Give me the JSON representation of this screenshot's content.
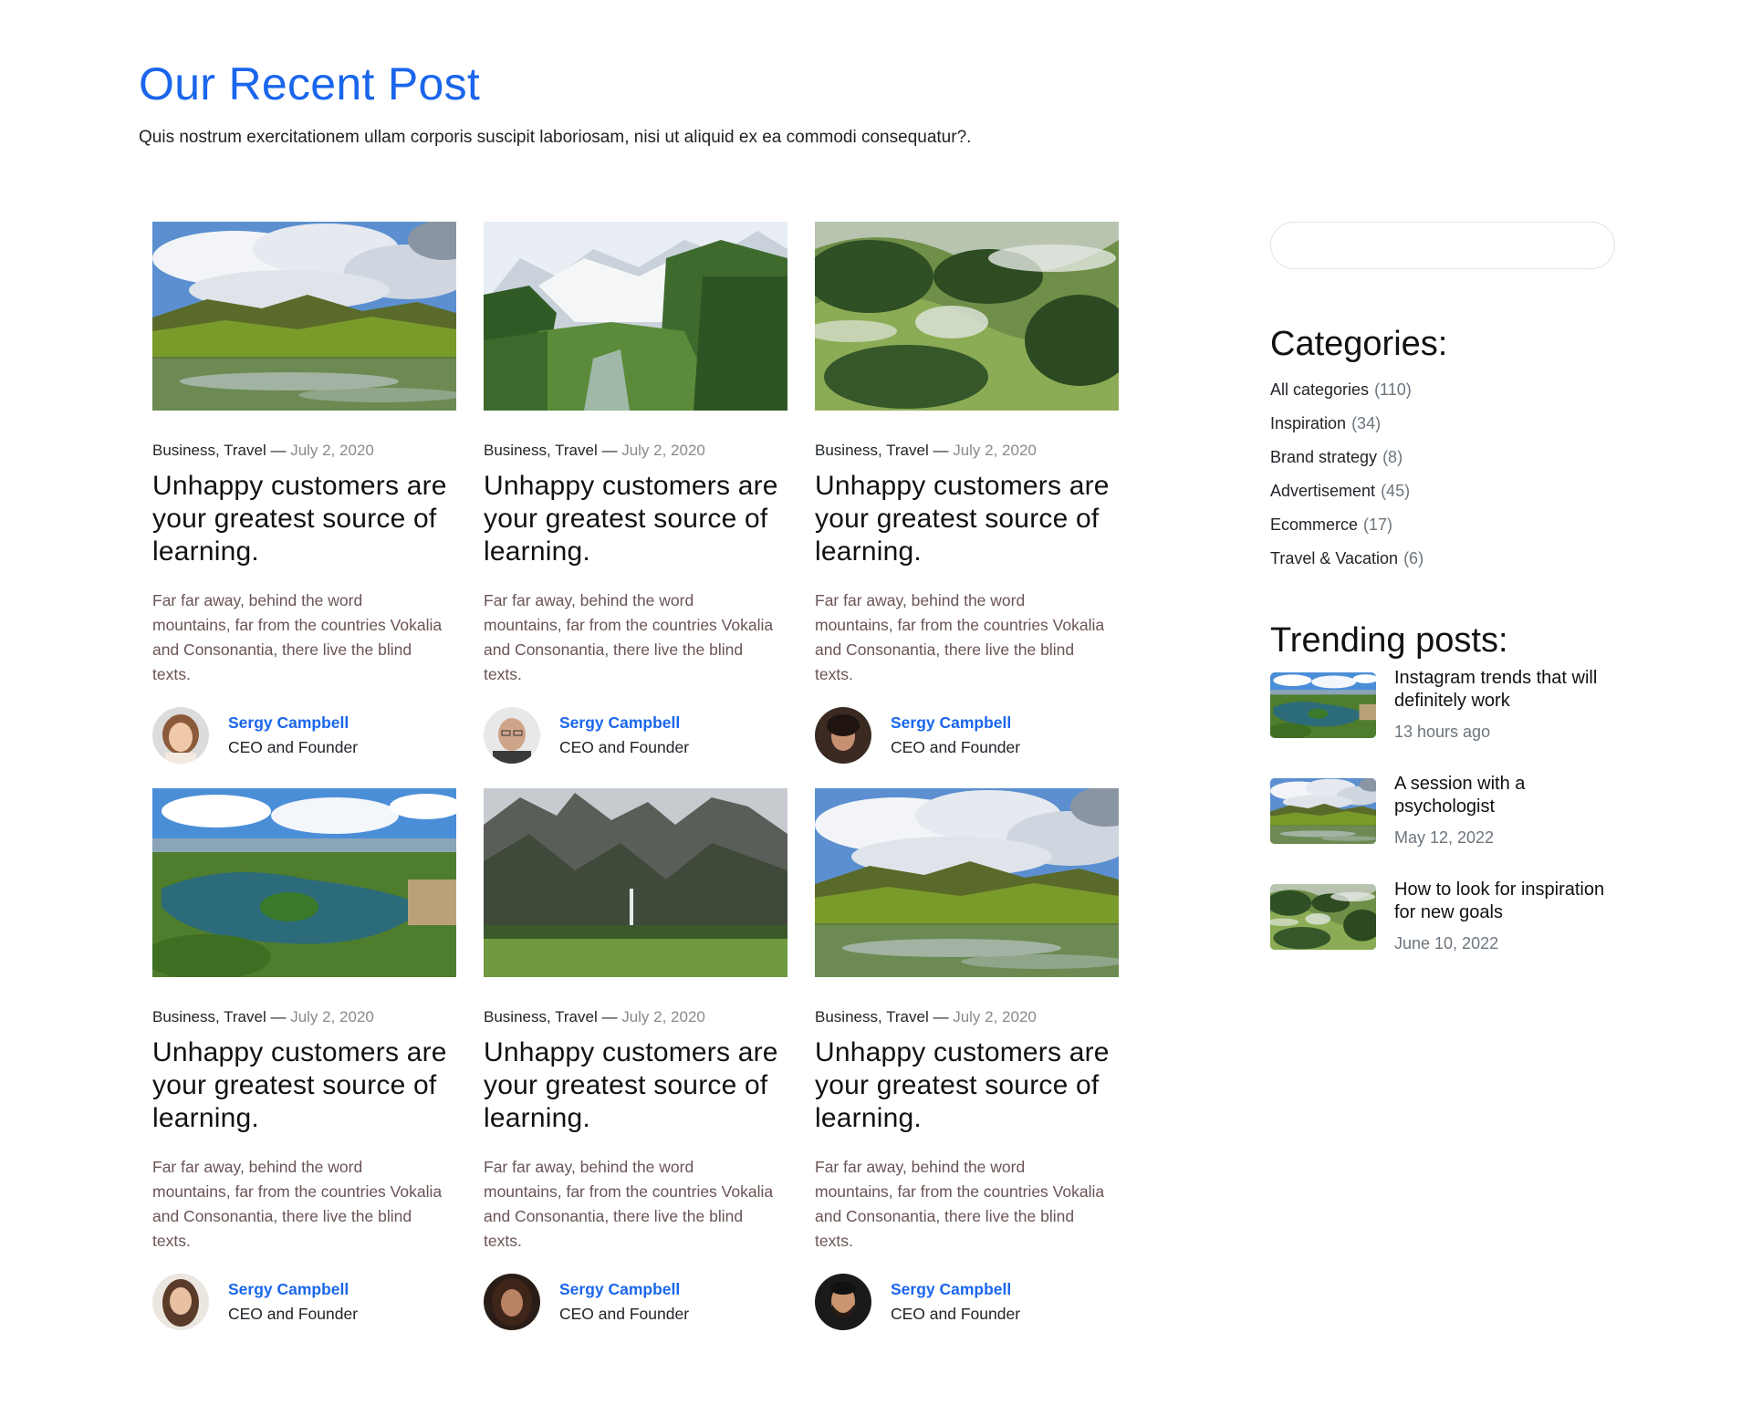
{
  "header": {
    "title": "Our Recent Post",
    "subtitle": "Quis nostrum exercitationem ullam corporis suscipit laboriosam, nisi ut aliquid ex ea commodi consequatur?."
  },
  "posts": [
    {
      "image": "lake-cloudy-mountains",
      "categories": "Business, Travel",
      "date": "July 2, 2020",
      "title": "Unhappy customers are your greatest source of learning.",
      "excerpt": "Far far away, behind the word mountains, far from the countries Vokalia and Consonantia, there live the blind texts.",
      "author": "Sergy Campbell",
      "role": "CEO and Founder",
      "avatar": "woman-short-hair"
    },
    {
      "image": "alpine-valley-glacier",
      "categories": "Business, Travel",
      "date": "July 2, 2020",
      "title": "Unhappy customers are your greatest source of learning.",
      "excerpt": "Far far away, behind the word mountains, far from the countries Vokalia and Consonantia, there live the blind texts.",
      "author": "Sergy Campbell",
      "role": "CEO and Founder",
      "avatar": "man-glasses"
    },
    {
      "image": "misty-green-hills",
      "categories": "Business, Travel",
      "date": "July 2, 2020",
      "title": "Unhappy customers are your greatest source of learning.",
      "excerpt": "Far far away, behind the word mountains, far from the countries Vokalia and Consonantia, there live the blind texts.",
      "author": "Sergy Campbell",
      "role": "CEO and Founder",
      "avatar": "woman-dark-hair"
    },
    {
      "image": "island-lake-aerial",
      "categories": "Business, Travel",
      "date": "July 2, 2020",
      "title": "Unhappy customers are your greatest source of learning.",
      "excerpt": "Far far away, behind the word mountains, far from the countries Vokalia and Consonantia, there live the blind texts.",
      "author": "Sergy Campbell",
      "role": "CEO and Founder",
      "avatar": "woman-long-hair"
    },
    {
      "image": "rocky-mountains-waterfall",
      "categories": "Business, Travel",
      "date": "July 2, 2020",
      "title": "Unhappy customers are your greatest source of learning.",
      "excerpt": "Far far away, behind the word mountains, far from the countries Vokalia and Consonantia, there live the blind texts.",
      "author": "Sergy Campbell",
      "role": "CEO and Founder",
      "avatar": "woman-curly-hair"
    },
    {
      "image": "lake-cloudy-mountains",
      "categories": "Business, Travel",
      "date": "July 2, 2020",
      "title": "Unhappy customers are your greatest source of learning.",
      "excerpt": "Far far away, behind the word mountains, far from the countries Vokalia and Consonantia, there live the blind texts.",
      "author": "Sergy Campbell",
      "role": "CEO and Founder",
      "avatar": "man-beard"
    }
  ],
  "sidebar": {
    "search": {
      "placeholder": "",
      "value": ""
    },
    "categories_heading": "Categories:",
    "categories": [
      {
        "label": "All categories",
        "count": "(110)"
      },
      {
        "label": "Inspiration",
        "count": "(34)"
      },
      {
        "label": "Brand strategy",
        "count": "(8)"
      },
      {
        "label": "Advertisement",
        "count": "(45)"
      },
      {
        "label": "Ecommerce",
        "count": "(17)"
      },
      {
        "label": "Travel & Vacation",
        "count": "(6)"
      }
    ],
    "trending_heading": "Trending posts:",
    "trending": [
      {
        "title": "Instagram trends that will definitely work",
        "date": "13 hours ago",
        "image": "island-lake-aerial"
      },
      {
        "title": "A session with a psychologist",
        "date": "May 12, 2022",
        "image": "lake-cloudy-mountains"
      },
      {
        "title": "How to look for inspiration for new goals",
        "date": "June 10, 2022",
        "image": "misty-green-hills"
      }
    ]
  },
  "colors": {
    "accent": "#1a66ec",
    "text": "#212529",
    "muted": "#8a8a8a",
    "excerpt": "#6b5454"
  }
}
